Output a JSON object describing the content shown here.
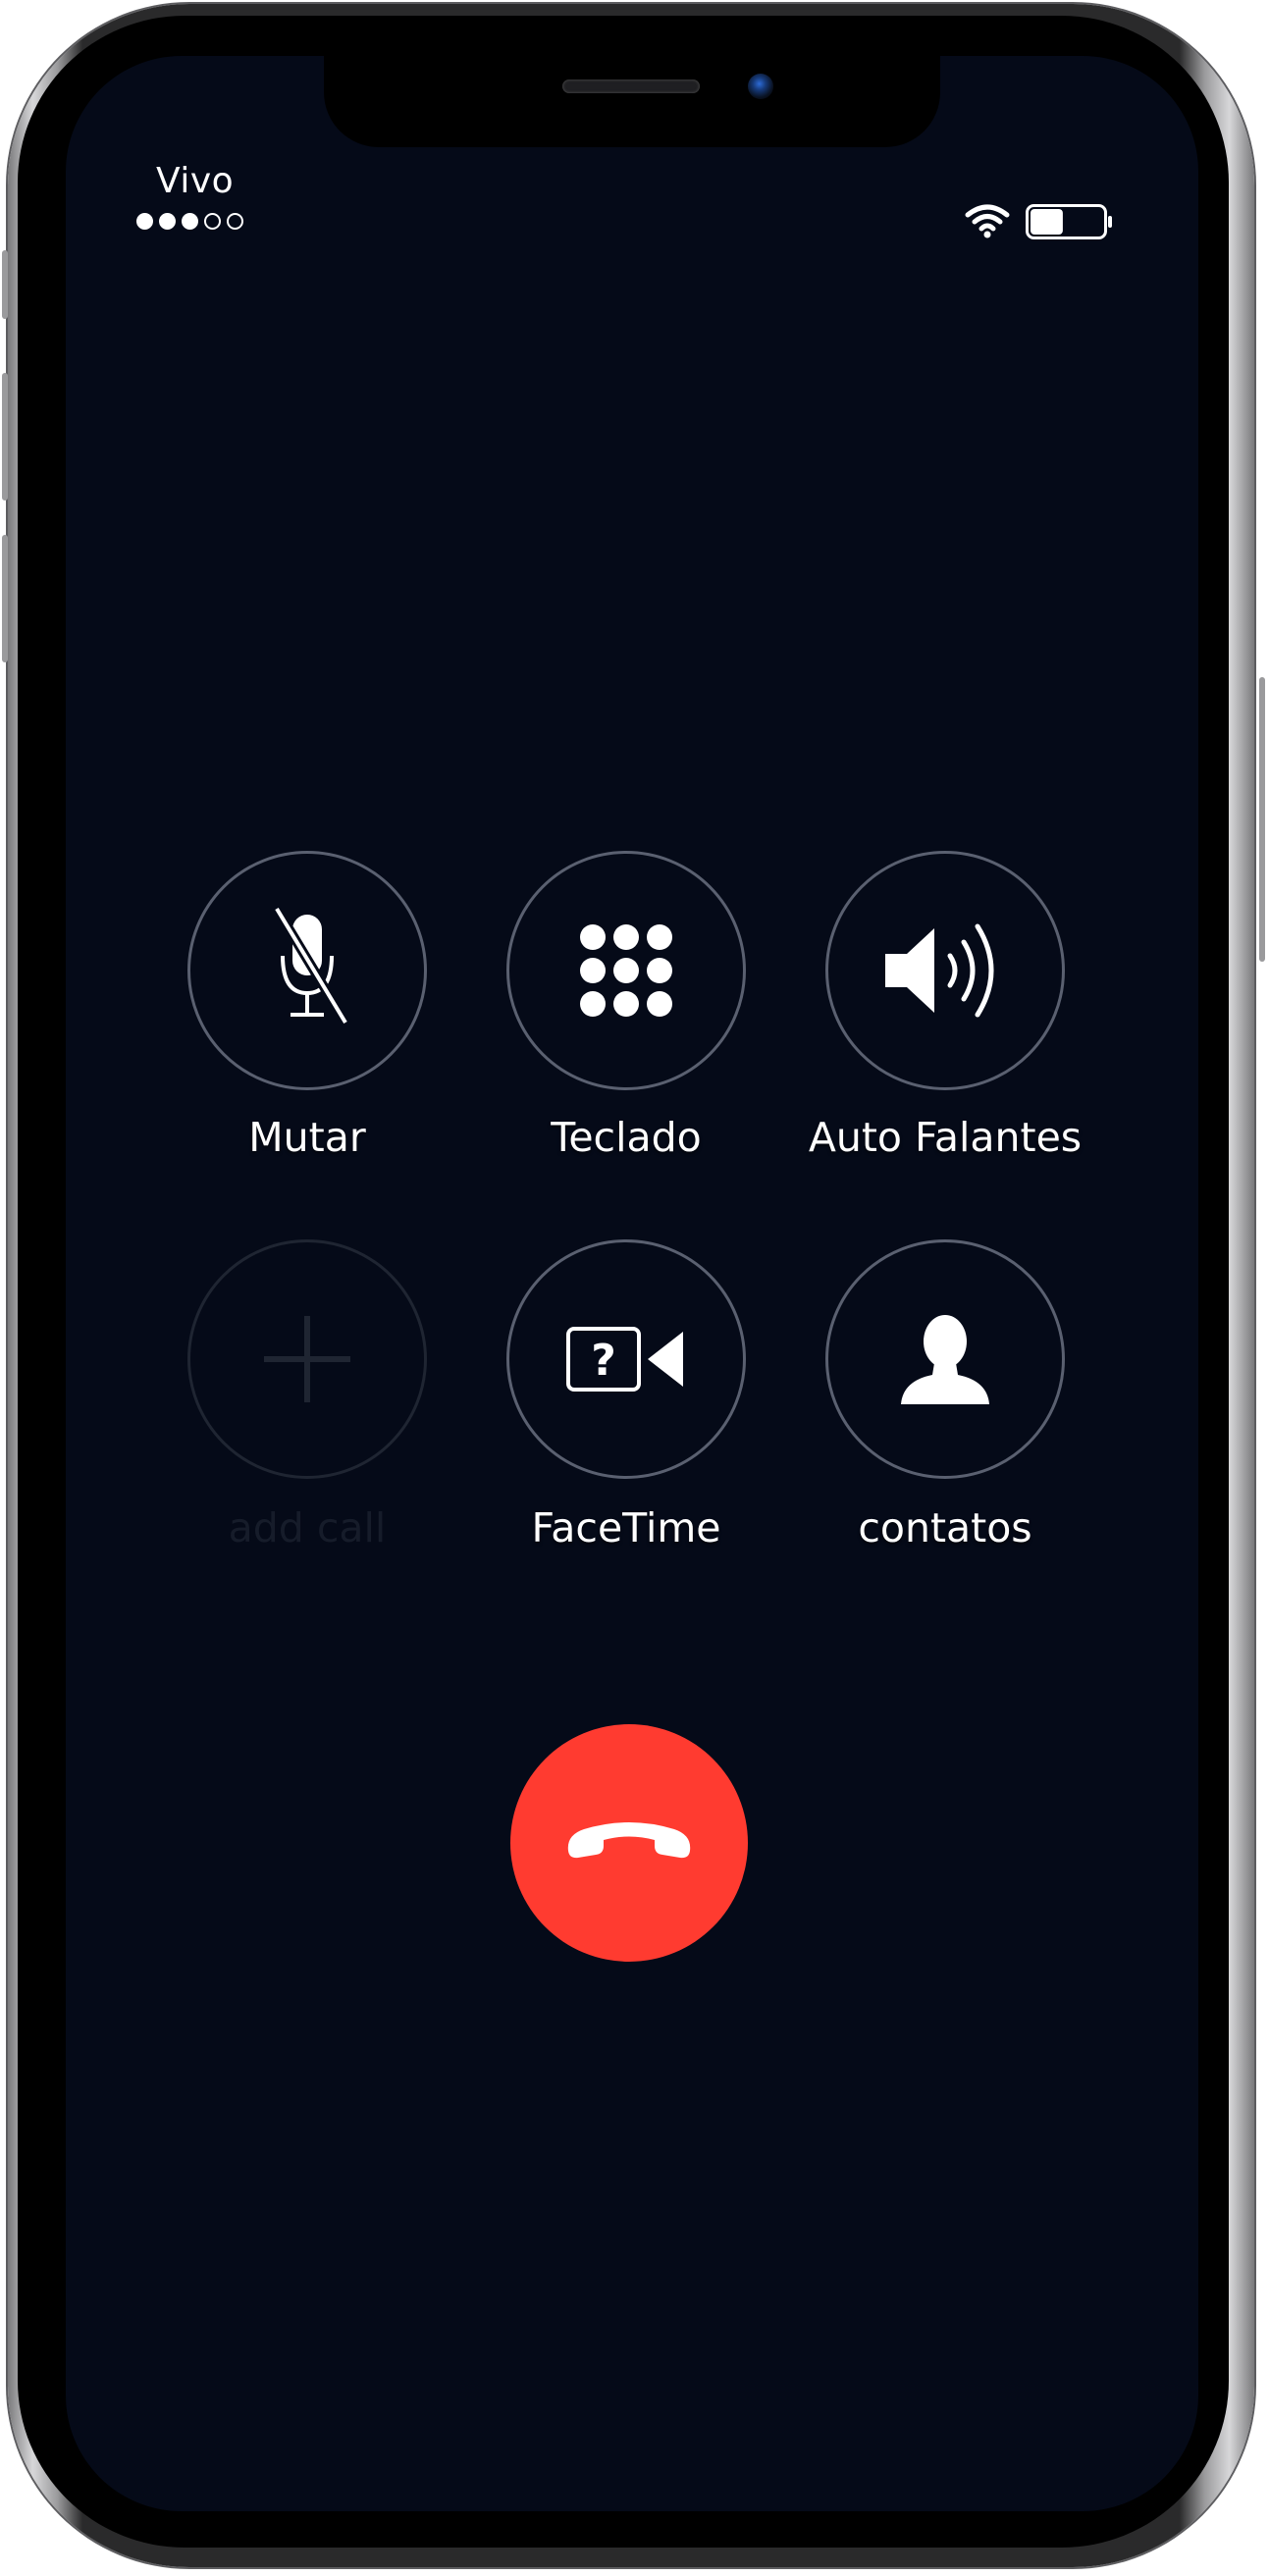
{
  "status_bar": {
    "carrier": "Vivo",
    "signal_bars_filled": 3,
    "signal_bars_total": 5,
    "wifi_icon": "wifi-icon",
    "battery_level": 0.45,
    "battery_icon": "battery-icon"
  },
  "controls": {
    "mute": {
      "label": "Mutar",
      "icon": "microphone-slash-icon",
      "enabled": true
    },
    "keypad": {
      "label": "Teclado",
      "icon": "keypad-icon",
      "enabled": true
    },
    "speaker": {
      "label": "Auto Falantes",
      "icon": "speaker-icon",
      "enabled": true
    },
    "add_call": {
      "label": "add call",
      "icon": "plus-icon",
      "enabled": false
    },
    "facetime": {
      "label": "FaceTime",
      "icon": "facetime-unknown-icon",
      "enabled": true
    },
    "contacts": {
      "label": "contatos",
      "icon": "contact-person-icon",
      "enabled": true
    }
  },
  "end_call": {
    "icon": "phone-hangup-icon"
  },
  "colors": {
    "screen_background": "#050a18",
    "end_call_red": "#ff3b30",
    "button_ring": "#5a6070",
    "disabled": "#1f2532",
    "text": "#ffffff"
  }
}
